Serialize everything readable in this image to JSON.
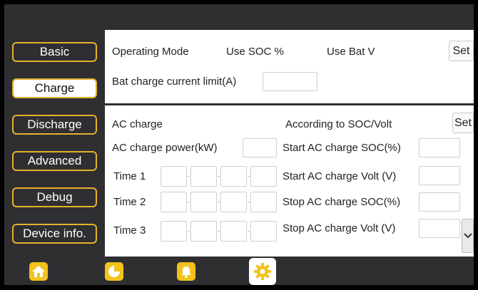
{
  "sidebar": {
    "items": [
      {
        "label": "Basic",
        "active": false
      },
      {
        "label": "Charge",
        "active": true
      },
      {
        "label": "Discharge",
        "active": false
      },
      {
        "label": "Advanced",
        "active": false
      },
      {
        "label": "Debug",
        "active": false
      },
      {
        "label": "Device info.",
        "active": false
      }
    ]
  },
  "settings": {
    "operating_mode_label": "Operating Mode",
    "option_soc": "Use SOC %",
    "option_batv": "Use Bat V",
    "set_label": "Set",
    "bat_charge_limit_label": "Bat charge current limit(A)",
    "bat_charge_limit_value": ""
  },
  "ac_charge": {
    "title": "AC charge",
    "mode_label": "According to SOC/Volt",
    "set_label": "Set",
    "power_label": "AC charge power(kW)",
    "power_value": "",
    "times": [
      {
        "label": "Time  1"
      },
      {
        "label": "Time  2"
      },
      {
        "label": "Time  3"
      }
    ],
    "right_fields": [
      {
        "label": "Start AC charge SOC(%)",
        "value": ""
      },
      {
        "label": "Start AC charge Volt (V)",
        "value": ""
      },
      {
        "label": "Stop AC charge SOC(%)",
        "value": ""
      },
      {
        "label": "Stop AC charge Volt (V)",
        "value": ""
      }
    ]
  },
  "bottom_nav": [
    {
      "icon": "home-icon",
      "active": false
    },
    {
      "icon": "pie-chart-icon",
      "active": false
    },
    {
      "icon": "bell-icon",
      "active": false
    },
    {
      "icon": "gear-icon",
      "active": true
    }
  ],
  "colors": {
    "accent": "#e3b22b",
    "nav_icon": "#f2c31c",
    "background": "#2f2f31",
    "panel": "#ffffff"
  }
}
